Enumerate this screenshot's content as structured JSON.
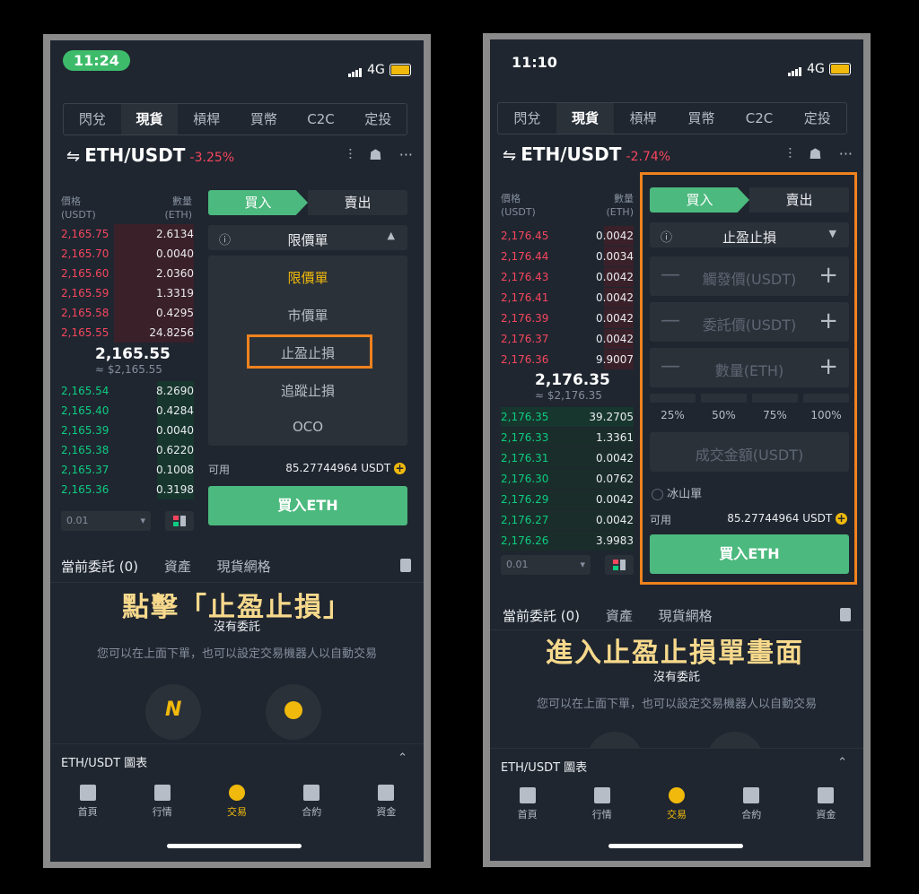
{
  "left": {
    "status": {
      "time": "11:24",
      "network": "4G"
    },
    "tabs": [
      "閃兌",
      "現貨",
      "槓桿",
      "買幣",
      "C2C",
      "定投"
    ],
    "header": {
      "pair": "ETH/USDT",
      "change": "-3.25%"
    },
    "orderbook": {
      "price_header": "價格\n(USDT)",
      "qty_header": "數量\n(ETH)",
      "asks": [
        {
          "price": "2,165.75",
          "qty": "2.6134"
        },
        {
          "price": "2,165.70",
          "qty": "0.0040"
        },
        {
          "price": "2,165.60",
          "qty": "2.0360"
        },
        {
          "price": "2,165.59",
          "qty": "1.3319"
        },
        {
          "price": "2,165.58",
          "qty": "0.4295"
        },
        {
          "price": "2,165.55",
          "qty": "24.8256"
        }
      ],
      "mid": "2,165.55",
      "mid_sub": "≈ $2,165.55",
      "bids": [
        {
          "price": "2,165.54",
          "qty": "8.2690"
        },
        {
          "price": "2,165.40",
          "qty": "0.4284"
        },
        {
          "price": "2,165.39",
          "qty": "0.0040"
        },
        {
          "price": "2,165.38",
          "qty": "0.6220"
        },
        {
          "price": "2,165.37",
          "qty": "0.1008"
        },
        {
          "price": "2,165.36",
          "qty": "0.3198"
        }
      ],
      "depth": "0.01"
    },
    "form": {
      "buy": "買入",
      "sell": "賣出",
      "order_type": "限價單",
      "dropdown": [
        "限價單",
        "市價單",
        "止盈止損",
        "追蹤止損",
        "OCO"
      ],
      "available_label": "可用",
      "available_value": "85.27744964 USDT",
      "buy_button": "買入ETH"
    },
    "bottom_tabs": [
      "當前委託 (0)",
      "資產",
      "現貨網格"
    ],
    "caption": "點擊「止盈止損」",
    "no_orders": "沒有委託",
    "hint": "您可以在上面下單，也可以設定交易機器人以自動交易",
    "chart_label": "ETH/USDT 圖表",
    "nav": [
      "首頁",
      "行情",
      "交易",
      "合約",
      "資金"
    ]
  },
  "right": {
    "status": {
      "time": "11:10",
      "network": "4G"
    },
    "tabs": [
      "閃兌",
      "現貨",
      "槓桿",
      "買幣",
      "C2C",
      "定投"
    ],
    "header": {
      "pair": "ETH/USDT",
      "change": "-2.74%"
    },
    "orderbook": {
      "price_header": "價格\n(USDT)",
      "qty_header": "數量\n(ETH)",
      "asks": [
        {
          "price": "2,176.45",
          "qty": "0.0042"
        },
        {
          "price": "2,176.44",
          "qty": "0.0034"
        },
        {
          "price": "2,176.43",
          "qty": "0.0042"
        },
        {
          "price": "2,176.41",
          "qty": "0.0042"
        },
        {
          "price": "2,176.39",
          "qty": "0.0042"
        },
        {
          "price": "2,176.37",
          "qty": "0.0042"
        },
        {
          "price": "2,176.36",
          "qty": "9.9007"
        }
      ],
      "mid": "2,176.35",
      "mid_sub": "≈ $2,176.35",
      "bids": [
        {
          "price": "2,176.35",
          "qty": "39.2705"
        },
        {
          "price": "2,176.33",
          "qty": "1.3361"
        },
        {
          "price": "2,176.31",
          "qty": "0.0042"
        },
        {
          "price": "2,176.30",
          "qty": "0.0762"
        },
        {
          "price": "2,176.29",
          "qty": "0.0042"
        },
        {
          "price": "2,176.27",
          "qty": "0.0042"
        },
        {
          "price": "2,176.26",
          "qty": "3.9983"
        }
      ],
      "depth": "0.01"
    },
    "form": {
      "buy": "買入",
      "sell": "賣出",
      "order_type": "止盈止損",
      "trigger_placeholder": "觸發價(USDT)",
      "limit_placeholder": "委託價(USDT)",
      "amount_placeholder": "數量(ETH)",
      "percents": [
        "25%",
        "50%",
        "75%",
        "100%"
      ],
      "total_placeholder": "成交金額(USDT)",
      "iceberg": "冰山單",
      "available_label": "可用",
      "available_value": "85.27744964 USDT",
      "buy_button": "買入ETH"
    },
    "bottom_tabs": [
      "當前委託 (0)",
      "資產",
      "現貨網格"
    ],
    "caption": "進入止盈止損單畫面",
    "no_orders": "沒有委託",
    "hint": "您可以在上面下單，也可以設定交易機器人以自動交易",
    "chart_label": "ETH/USDT 圖表",
    "nav": [
      "首頁",
      "行情",
      "交易",
      "合約",
      "資金"
    ]
  },
  "colors": {
    "ask": "#f6465d",
    "bid": "#0ecb81",
    "buy_button": "#4cb97e",
    "accent": "#f0b90b",
    "highlight": "#f0821e"
  }
}
